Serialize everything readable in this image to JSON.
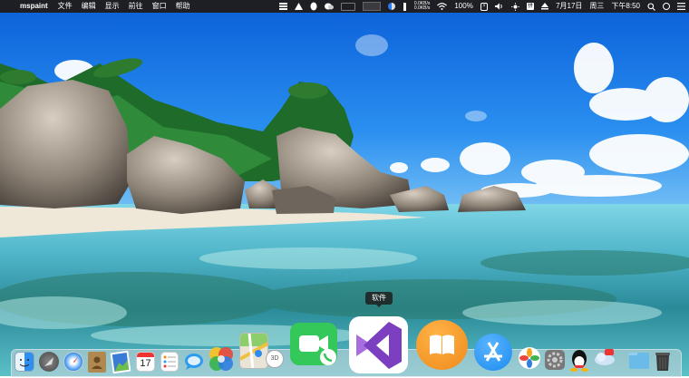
{
  "menubar": {
    "apple_glyph": "",
    "app_name": "mspaint",
    "menus": [
      "文件",
      "编辑",
      "显示",
      "前往",
      "窗口",
      "帮助"
    ],
    "network": {
      "up": "0.0KB/s",
      "down": "0.0KB/s"
    },
    "battery_percent": "100%",
    "battery_icon_text": "⚡",
    "input_method": "拼",
    "date": "7月17日",
    "weekday": "周三",
    "time": "下午8:50"
  },
  "tooltip": {
    "label": "软件"
  },
  "dock": {
    "apps": [
      "finder-icon",
      "launchpad-icon",
      "safari-icon",
      "contacts-icon",
      "photo-preview-icon",
      "calendar-icon",
      "reminders-icon",
      "messages-icon",
      "photos-icon",
      "maps-icon",
      "photo-3d-icon",
      "facetime-icon",
      "visual-studio-icon",
      "books-icon",
      "app-store-icon",
      "photos-flower-icon",
      "system-preferences-icon",
      "qq-icon",
      "weather-icon",
      "downloads-folder-icon",
      "trash-icon"
    ],
    "calendar_day": "17",
    "photo3d_label": "3D"
  },
  "colors": {
    "menubar_bg": "#1e1f24",
    "sky": "#1a7ee6",
    "facetime_green": "#34c759",
    "vs_purple": "#7b3fbf",
    "books_orange": "#f08a1c",
    "appstore_blue": "#1c8cf0"
  }
}
